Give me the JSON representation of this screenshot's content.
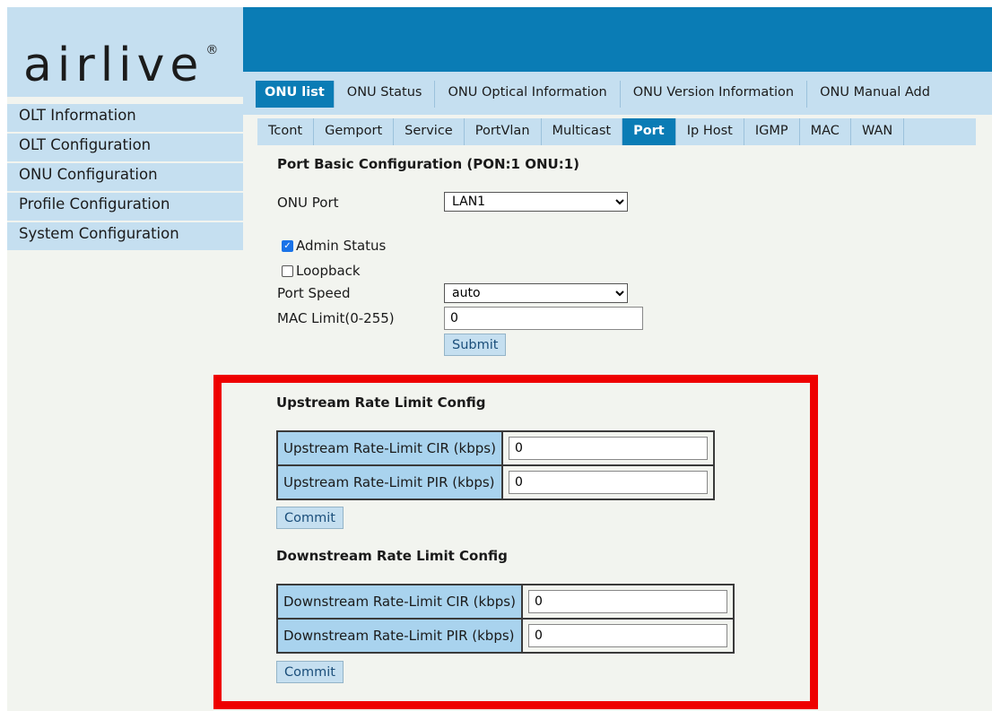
{
  "logo": {
    "text": "airlive",
    "mark": "®"
  },
  "sidebar": {
    "items": [
      {
        "label": "OLT Information"
      },
      {
        "label": "OLT Configuration"
      },
      {
        "label": "ONU Configuration"
      },
      {
        "label": "Profile Configuration"
      },
      {
        "label": "System Configuration"
      }
    ]
  },
  "tabs_primary": [
    {
      "label": "ONU list",
      "active": true
    },
    {
      "label": "ONU Status"
    },
    {
      "label": "ONU Optical Information"
    },
    {
      "label": "ONU Version Information"
    },
    {
      "label": "ONU Manual Add"
    }
  ],
  "tabs_secondary": [
    {
      "label": "Tcont"
    },
    {
      "label": "Gemport"
    },
    {
      "label": "Service"
    },
    {
      "label": "PortVlan"
    },
    {
      "label": "Multicast"
    },
    {
      "label": "Port",
      "active": true
    },
    {
      "label": "Ip Host"
    },
    {
      "label": "IGMP"
    },
    {
      "label": "MAC"
    },
    {
      "label": "WAN"
    }
  ],
  "basic": {
    "title": "Port Basic Configuration (PON:1 ONU:1)",
    "onu_port_label": "ONU Port",
    "onu_port_value": "LAN1",
    "admin_status_label": "Admin Status",
    "admin_status_checked": true,
    "loopback_label": "Loopback",
    "loopback_checked": false,
    "port_speed_label": "Port Speed",
    "port_speed_value": "auto",
    "mac_limit_label": "MAC Limit(0-255)",
    "mac_limit_value": "0",
    "submit_label": "Submit"
  },
  "upstream": {
    "title": "Upstream Rate Limit Config",
    "cir_label": "Upstream Rate-Limit CIR (kbps)",
    "cir_value": "0",
    "pir_label": "Upstream Rate-Limit PIR (kbps)",
    "pir_value": "0",
    "commit_label": "Commit"
  },
  "downstream": {
    "title": "Downstream Rate Limit Config",
    "cir_label": "Downstream Rate-Limit CIR (kbps)",
    "cir_value": "0",
    "pir_label": "Downstream Rate-Limit PIR (kbps)",
    "pir_value": "0",
    "commit_label": "Commit"
  },
  "colors": {
    "brand_blue": "#0a7cb5",
    "light_blue": "#c5dff0",
    "highlight_red": "#ee0000"
  }
}
